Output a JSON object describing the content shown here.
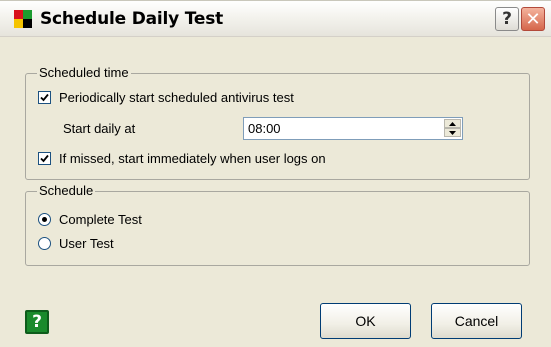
{
  "window": {
    "title": "Schedule Daily Test",
    "help_glyph": "?",
    "close_glyph": "✕",
    "icon_colors": [
      "#d8101b",
      "#1b9b2e",
      "#f5c400",
      "#000000"
    ]
  },
  "scheduled_time": {
    "legend": "Scheduled time",
    "periodic_label": "Periodically start scheduled antivirus test",
    "periodic_checked": true,
    "start_label": "Start daily at",
    "start_value": "08:00",
    "missed_label": "If missed, start immediately when user logs on",
    "missed_checked": true
  },
  "schedule": {
    "legend": "Schedule",
    "options": [
      {
        "label": "Complete Test",
        "selected": true
      },
      {
        "label": "User Test",
        "selected": false
      }
    ]
  },
  "footer": {
    "help_glyph": "?",
    "ok_label": "OK",
    "cancel_label": "Cancel"
  }
}
